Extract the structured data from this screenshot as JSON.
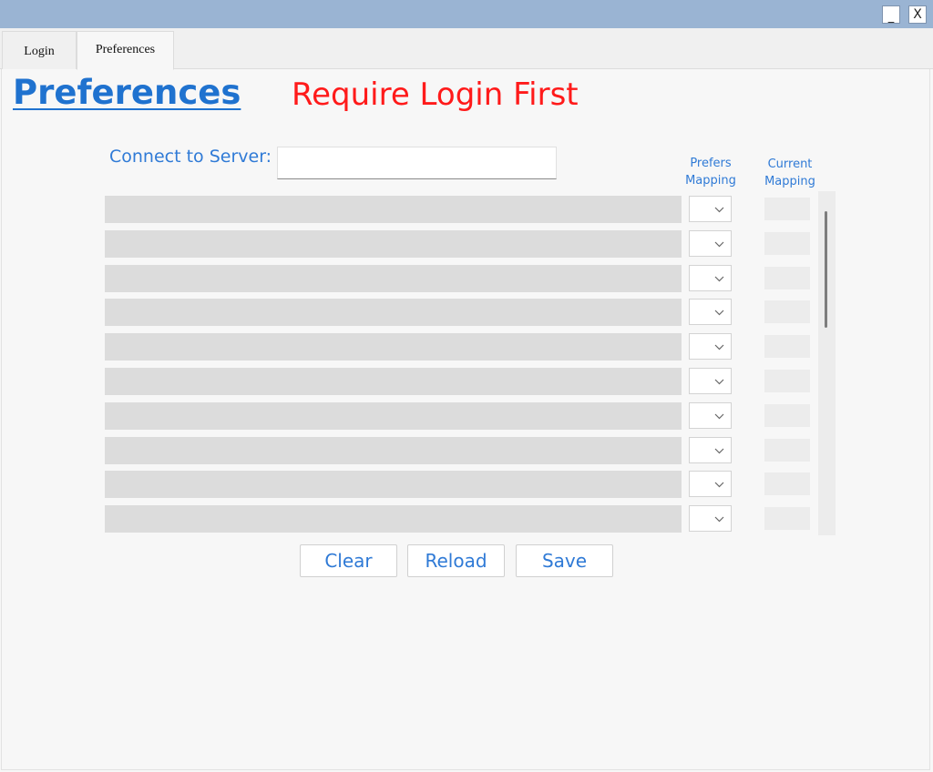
{
  "window": {
    "minimize_label": "_",
    "close_label": "X"
  },
  "tabs": [
    {
      "label": "Login",
      "active": false
    },
    {
      "label": "Preferences",
      "active": true
    }
  ],
  "page": {
    "title": "Preferences",
    "warning": "Require Login First",
    "warning_color": "#ff1a1a",
    "accent_color": "#2f7ad6"
  },
  "server": {
    "label": "Connect to Server:",
    "value": ""
  },
  "columns": {
    "prefers": "Prefers\nMapping",
    "current": "Current\nMapping"
  },
  "rows": [
    {
      "name": "",
      "prefers": "",
      "current": ""
    },
    {
      "name": "",
      "prefers": "",
      "current": ""
    },
    {
      "name": "",
      "prefers": "",
      "current": ""
    },
    {
      "name": "",
      "prefers": "",
      "current": ""
    },
    {
      "name": "",
      "prefers": "",
      "current": ""
    },
    {
      "name": "",
      "prefers": "",
      "current": ""
    },
    {
      "name": "",
      "prefers": "",
      "current": ""
    },
    {
      "name": "",
      "prefers": "",
      "current": ""
    },
    {
      "name": "",
      "prefers": "",
      "current": ""
    },
    {
      "name": "",
      "prefers": "",
      "current": ""
    }
  ],
  "buttons": {
    "clear": "Clear",
    "reload": "Reload",
    "save": "Save"
  },
  "icons": {
    "dropdown": "chevron-down-icon",
    "minimize": "minimize-icon",
    "close": "close-icon"
  }
}
